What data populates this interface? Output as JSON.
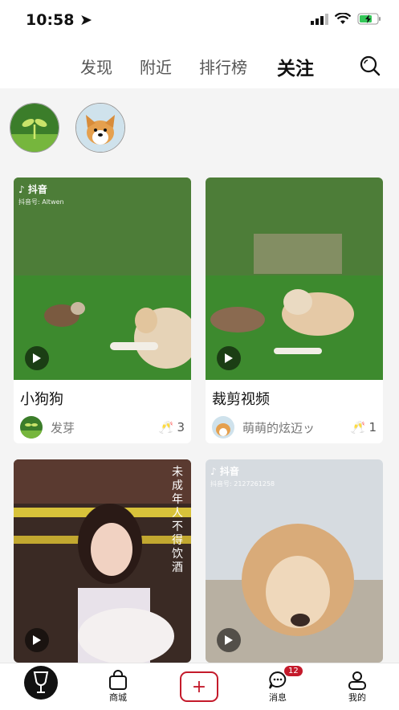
{
  "status_bar": {
    "time": "10:58"
  },
  "top_nav": {
    "tabs": [
      "发现",
      "附近",
      "排行榜",
      "关注"
    ]
  },
  "feed": {
    "cards": [
      {
        "watermark": "抖音",
        "watermark_id": "抖音号: Altwen",
        "title": "小狗狗",
        "author": "发芽",
        "likes": "3"
      },
      {
        "title": "裁剪视频",
        "author": "萌萌的炫迈ッ",
        "likes": "1"
      },
      {
        "overlay_text": [
          "未",
          "成",
          "年",
          "人",
          "不",
          "得",
          "饮",
          "酒"
        ]
      },
      {
        "watermark": "抖音",
        "watermark_id": "抖音号: 2127261258"
      }
    ]
  },
  "tab_bar": {
    "store": "商城",
    "messages": "消息",
    "messages_badge": "12",
    "me": "我的"
  },
  "colors": {
    "accent": "#c41a2b"
  }
}
